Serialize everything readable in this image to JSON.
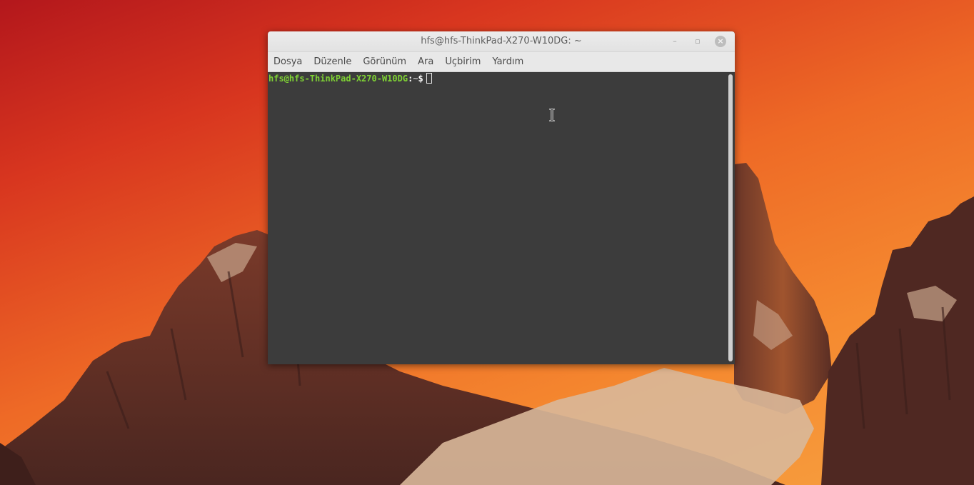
{
  "window": {
    "title": "hfs@hfs-ThinkPad-X270-W10DG: ~",
    "controls": {
      "minimize": "–",
      "maximize": "▫",
      "close": "×"
    }
  },
  "menu": {
    "items": [
      {
        "label": "Dosya"
      },
      {
        "label": "Düzenle"
      },
      {
        "label": "Görünüm"
      },
      {
        "label": "Ara"
      },
      {
        "label": "Uçbirim"
      },
      {
        "label": "Yardım"
      }
    ]
  },
  "terminal": {
    "prompt_user_host": "hfs@hfs-ThinkPad-X270-W10DG",
    "prompt_separator": ":",
    "prompt_path": "~",
    "prompt_symbol": "$"
  },
  "colors": {
    "prompt_user": "#7fd234",
    "terminal_bg": "#3c3c3c",
    "wallpaper_sky": "#ee6a26"
  },
  "icons": {
    "mouse_cursor": "ibeam-cursor-icon"
  }
}
